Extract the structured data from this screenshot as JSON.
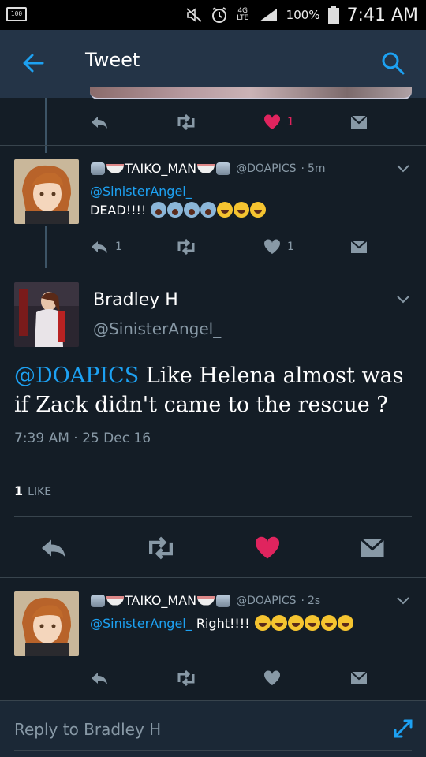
{
  "status_bar": {
    "battery_small": "100",
    "network": "4G LTE",
    "battery": "100%",
    "time": "7:41 AM"
  },
  "header": {
    "title": "Tweet"
  },
  "tweet_above": {
    "likes": "1"
  },
  "reply_1": {
    "name": "TAIKO_MAN",
    "handle": "@DOAPICS",
    "time": "5m",
    "mention": "@SinisterAngel_",
    "text": "DEAD!!!!",
    "replies": "1",
    "likes": "1"
  },
  "main_tweet": {
    "name": "Bradley H",
    "handle": "@SinisterAngel_",
    "mention": "@DOAPICS",
    "text": "Like Helena almost was if Zack didn't came to the rescue ?",
    "timestamp": "7:39 AM",
    "date": "25 Dec 16",
    "like_count": "1",
    "like_label": "LIKE"
  },
  "reply_2": {
    "name": "TAIKO_MAN",
    "handle": "@DOAPICS",
    "time": "2s",
    "mention": "@SinisterAngel_",
    "text": "Right!!!!"
  },
  "composer": {
    "placeholder": "Reply to Bradley H"
  },
  "colors": {
    "background": "#141d26",
    "header": "#243447",
    "accent": "#1da1f2",
    "like": "#e0245e",
    "muted": "#8899a6"
  }
}
